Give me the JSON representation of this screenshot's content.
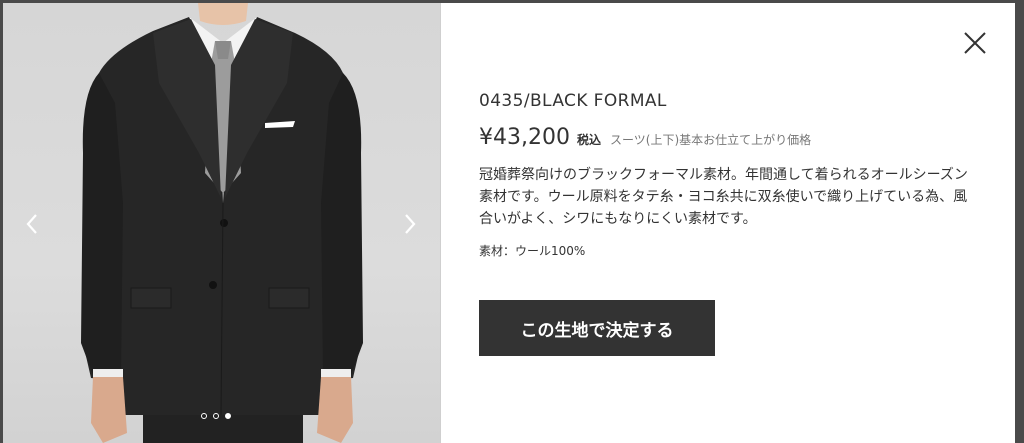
{
  "gallery": {
    "image_alt": "black formal suit jacket on model",
    "prev_icon": "chevron-left-icon",
    "next_icon": "chevron-right-icon",
    "slide_count": 3,
    "active_slide": 3
  },
  "close": {
    "icon": "close-icon"
  },
  "product": {
    "name": "0435/BLACK FORMAL",
    "price": "¥43,200",
    "tax_label": "税込",
    "price_note": "スーツ(上下)基本お仕立て上がり価格",
    "description": "冠婚葬祭向けのブラックフォーマル素材。年間通して着られるオールシーズン素材です。ウール原料をタテ糸・ヨコ糸共に双糸使いで織り上げている為、風合いがよく、シワにもなりにくい素材です。",
    "material": "素材：ウール100%"
  },
  "actions": {
    "decide_label": "この生地で決定する"
  },
  "colors": {
    "button_bg": "#333333",
    "backdrop": "#4a4a4a"
  }
}
